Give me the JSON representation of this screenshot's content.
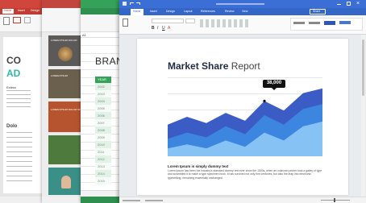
{
  "windows": {
    "presentation": {
      "accent": "#d0463d",
      "tabs": [
        "Home",
        "Insert",
        "Design"
      ],
      "slide": {
        "title_line1": "CO",
        "title_line2": "AD",
        "text1": "Extend",
        "text2": "Data",
        "heading2": "Dolo"
      }
    },
    "slides_panel": {
      "accent": "#c3463e",
      "thumbs": [
        {
          "title": "LOREM IPSUM DOLOR"
        },
        {
          "title": "LOREM IPSUM"
        },
        {
          "title": "LOREM IPSUM DOLOR SIT"
        },
        {
          "title": ""
        },
        {
          "title": ""
        }
      ]
    },
    "spreadsheet": {
      "accent": "#35a25a",
      "cell_ref": "A1",
      "title_fragment": "BRAN",
      "header": "YEAR",
      "years": [
        "2002",
        "2003",
        "2004",
        "2005",
        "2006",
        "2007",
        "2008",
        "2009",
        "2010",
        "2011",
        "2012",
        "2013",
        "2014",
        "2015"
      ]
    },
    "writer": {
      "accent": "#3b6fd6",
      "tabs": [
        "Home",
        "Insert",
        "Design",
        "Layout",
        "References",
        "Review",
        "View"
      ],
      "share_label": "Share",
      "chart_title_bold": "Market Share",
      "chart_title_light": "Report",
      "callout_value": "38,000",
      "caption_heading": "Lorem Ipsum is simply dummy text",
      "caption_text": "Lorem Ipsum has been the industry's standard dummy text ever since the 1500s, when an unknown printer took a galley of type and scrambled it to make a type specimen book. It has survived not only five centuries, but also the leap into electronic typesetting, remaining essentially unchanged."
    }
  },
  "chart_data": {
    "type": "area",
    "title": "Market Share Report",
    "x": [
      0,
      1,
      2,
      3,
      4,
      5,
      6,
      7,
      8
    ],
    "ylim": [
      0,
      100
    ],
    "annotation": "38,000",
    "series": [
      {
        "color": "#3a5cc4",
        "values": [
          40,
          50,
          42,
          55,
          45,
          70,
          58,
          80,
          86
        ]
      },
      {
        "color": "#3d86e0",
        "values": [
          22,
          30,
          24,
          38,
          28,
          52,
          40,
          60,
          66
        ]
      },
      {
        "color": "#86c2f4",
        "values": [
          10,
          15,
          10,
          20,
          12,
          30,
          20,
          38,
          44
        ]
      }
    ],
    "grid": true
  }
}
